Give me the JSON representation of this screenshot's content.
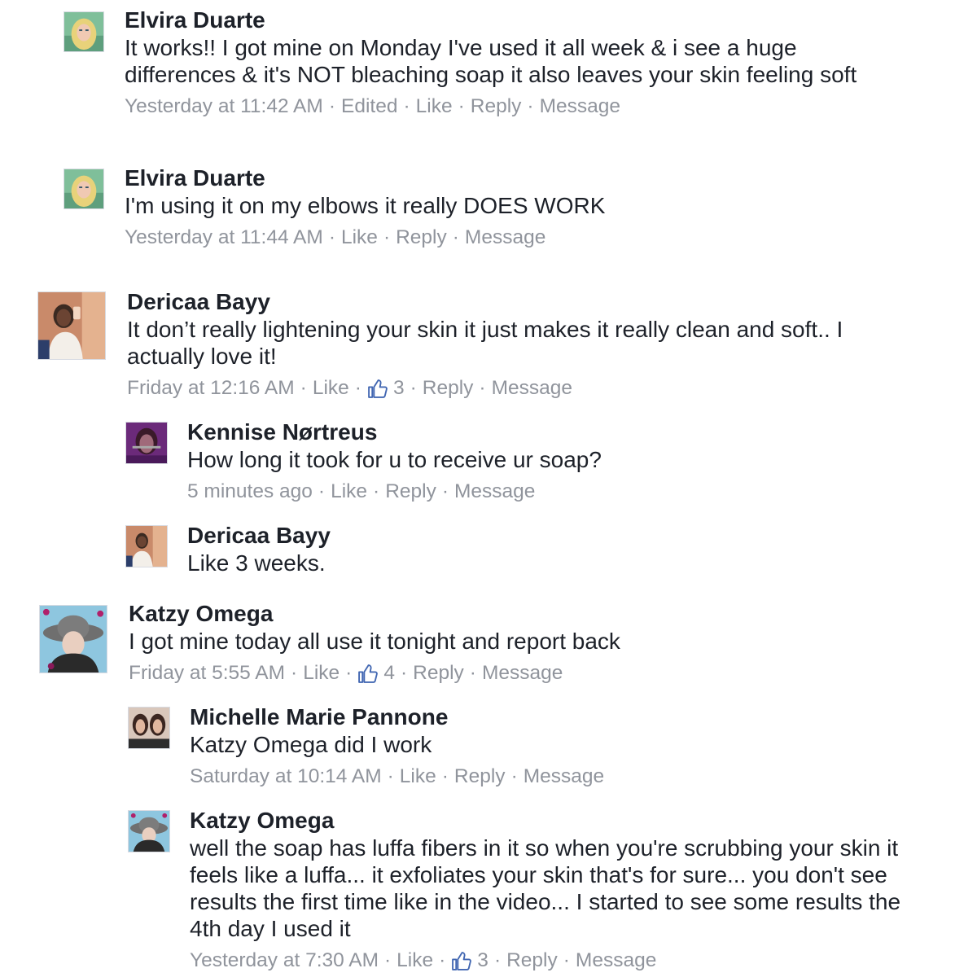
{
  "colors": {
    "name": "#1d2129",
    "text": "#1d2129",
    "meta": "#90949c",
    "like_icon": "#4267b2"
  },
  "comments": [
    {
      "author": "Elvira Duarte",
      "text": "It works!! I got mine on Monday I've used it all week & i see a huge differences & it's NOT bleaching soap it also leaves your skin feeling soft",
      "time": "Yesterday at 11:42 AM",
      "edited": "Edited",
      "like": "Like",
      "reply": "Reply",
      "message": "Message"
    },
    {
      "author": "Elvira Duarte",
      "text": "I'm using it on my elbows it really DOES WORK",
      "time": "Yesterday at 11:44 AM",
      "like": "Like",
      "reply": "Reply",
      "message": "Message"
    },
    {
      "author": "Dericaa Bayy",
      "text": "It don’t really lightening your skin it just makes it really clean and soft.. I actually love it!",
      "time": "Friday at 12:16 AM",
      "like": "Like",
      "like_icon": "thumbs-up-icon",
      "like_count": "3",
      "reply": "Reply",
      "message": "Message"
    },
    {
      "author": "Kennise Nørtreus",
      "text": "How long it took for u to receive ur soap?",
      "time": "5 minutes ago",
      "like": "Like",
      "reply": "Reply",
      "message": "Message"
    },
    {
      "author": "Dericaa Bayy",
      "text": "Like 3 weeks."
    },
    {
      "author": "Katzy Omega",
      "text": "I got mine today all use it tonight and report back",
      "time": "Friday at 5:55 AM",
      "like": "Like",
      "like_icon": "thumbs-up-icon",
      "like_count": "4",
      "reply": "Reply",
      "message": "Message"
    },
    {
      "author": "Michelle Marie Pannone",
      "text": "Katzy Omega did I work",
      "time": "Saturday at 10:14 AM",
      "like": "Like",
      "reply": "Reply",
      "message": "Message"
    },
    {
      "author": "Katzy Omega",
      "text": "well the soap has luffa fibers in it so when you're scrubbing your skin it feels like a luffa... it exfoliates your skin that's for sure...  you don't see results the first time like in the video... I started to see some results the 4th day I used it",
      "time": "Yesterday at 7:30 AM",
      "like": "Like",
      "like_icon": "thumbs-up-icon",
      "like_count": "3",
      "reply": "Reply",
      "message": "Message"
    }
  ]
}
